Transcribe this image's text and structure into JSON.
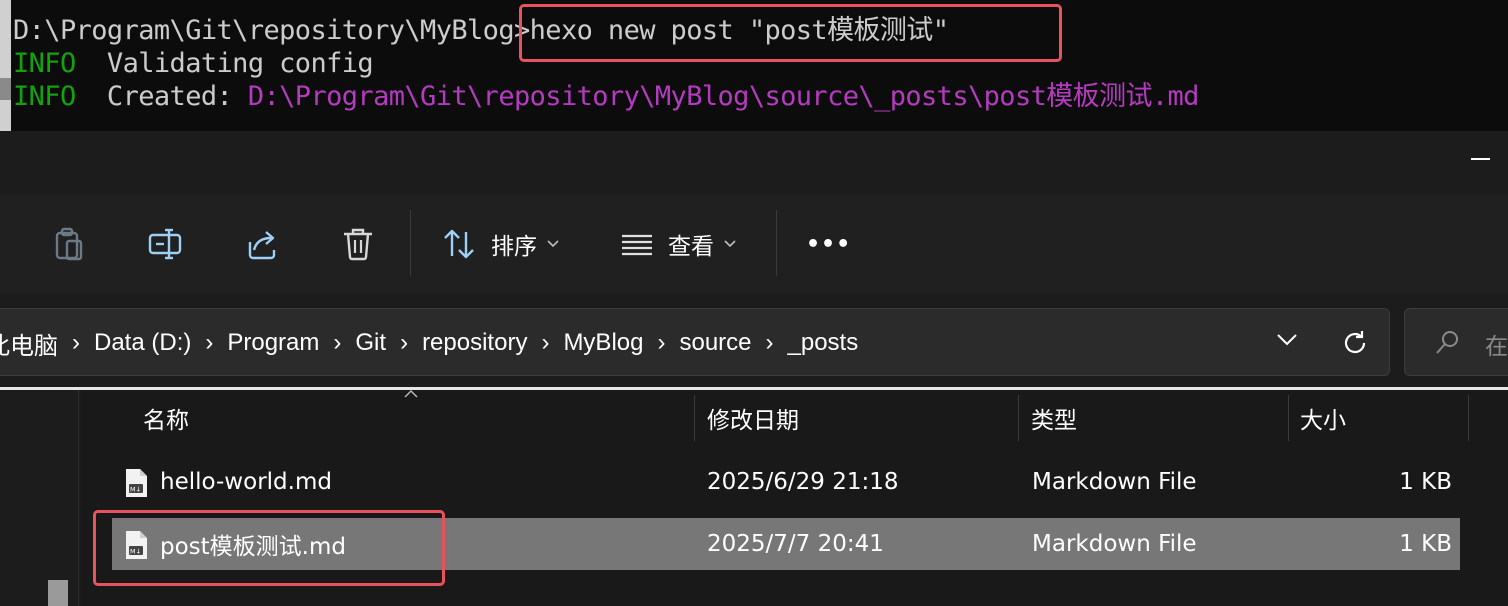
{
  "terminal": {
    "line1": {
      "prompt": "D:\\Program\\Git\\repository\\MyBlog>",
      "command": "hexo new post \"post模板测试\""
    },
    "line2": {
      "level": "INFO",
      "message": "  Validating config"
    },
    "line3": {
      "level": "INFO",
      "message": "  Created: ",
      "path": "D:\\Program\\Git\\repository\\MyBlog\\source\\_posts\\post模板测试.md"
    }
  },
  "toolbar": {
    "sort_label": "排序",
    "view_label": "查看",
    "more_label": "•••"
  },
  "address": {
    "crumbs": [
      "此电脑",
      "Data (D:)",
      "Program",
      "Git",
      "repository",
      "MyBlog",
      "source",
      "_posts"
    ],
    "separator": "›"
  },
  "search": {
    "placeholder": "在"
  },
  "columns": {
    "name": "名称",
    "modified": "修改日期",
    "type": "类型",
    "size": "大小"
  },
  "files": [
    {
      "name": "hello-world.md",
      "modified": "2025/6/29 21:18",
      "type": "Markdown File",
      "size": "1 KB"
    },
    {
      "name": "post模板测试.md",
      "modified": "2025/7/7 20:41",
      "type": "Markdown File",
      "size": "1 KB"
    }
  ],
  "colors": {
    "highlight": "#e8535f",
    "info": "#13a10e",
    "path": "#b43bbf",
    "selected_row": "#777777"
  }
}
